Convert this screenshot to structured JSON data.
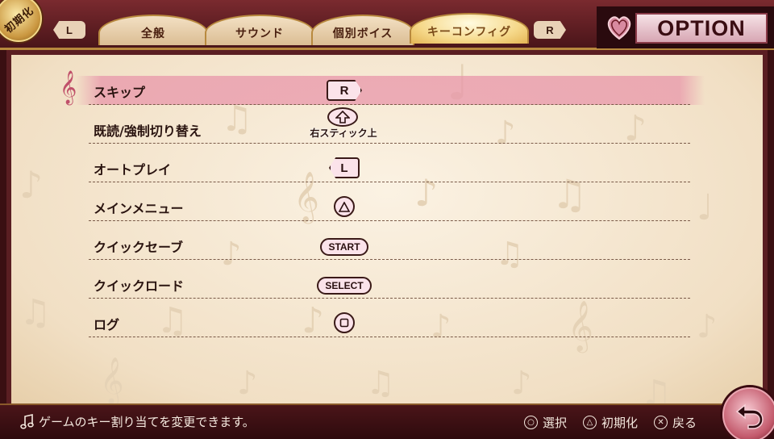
{
  "header": {
    "reset_label": "初期化",
    "left_shoulder": "L",
    "right_shoulder": "R",
    "tabs": [
      {
        "label": "全般",
        "active": false
      },
      {
        "label": "サウンド",
        "active": false
      },
      {
        "label": "個別ボイス",
        "active": false
      },
      {
        "label": "キーコンフィグ",
        "active": true
      }
    ],
    "title": "OPTION"
  },
  "keyconfig": {
    "selected_index": 0,
    "rows": [
      {
        "label": "スキップ",
        "button": "R",
        "icon": "r-button-icon"
      },
      {
        "label": "既読/強制切り替え",
        "button": "右スティック上",
        "icon": "right-stick-up-icon"
      },
      {
        "label": "オートプレイ",
        "button": "L",
        "icon": "l-button-icon"
      },
      {
        "label": "メインメニュー",
        "button": "△",
        "icon": "triangle-button-icon"
      },
      {
        "label": "クイックセーブ",
        "button": "START",
        "icon": "start-button-icon"
      },
      {
        "label": "クイックロード",
        "button": "SELECT",
        "icon": "select-button-icon"
      },
      {
        "label": "ログ",
        "button": "□",
        "icon": "square-button-icon"
      }
    ]
  },
  "footer": {
    "help_text": "ゲームのキー割り当てを変更できます。",
    "controls": [
      {
        "icon": "circle-button-icon",
        "glyph": "○",
        "label": "選択"
      },
      {
        "icon": "triangle-button-icon",
        "glyph": "△",
        "label": "初期化"
      },
      {
        "icon": "cross-button-icon",
        "glyph": "✕",
        "label": "戻る"
      }
    ]
  },
  "colors": {
    "frame": "#5a1e22",
    "panel": "#f6e9d6",
    "highlight": "#e896aa",
    "active_tab": "#f6d98b"
  }
}
